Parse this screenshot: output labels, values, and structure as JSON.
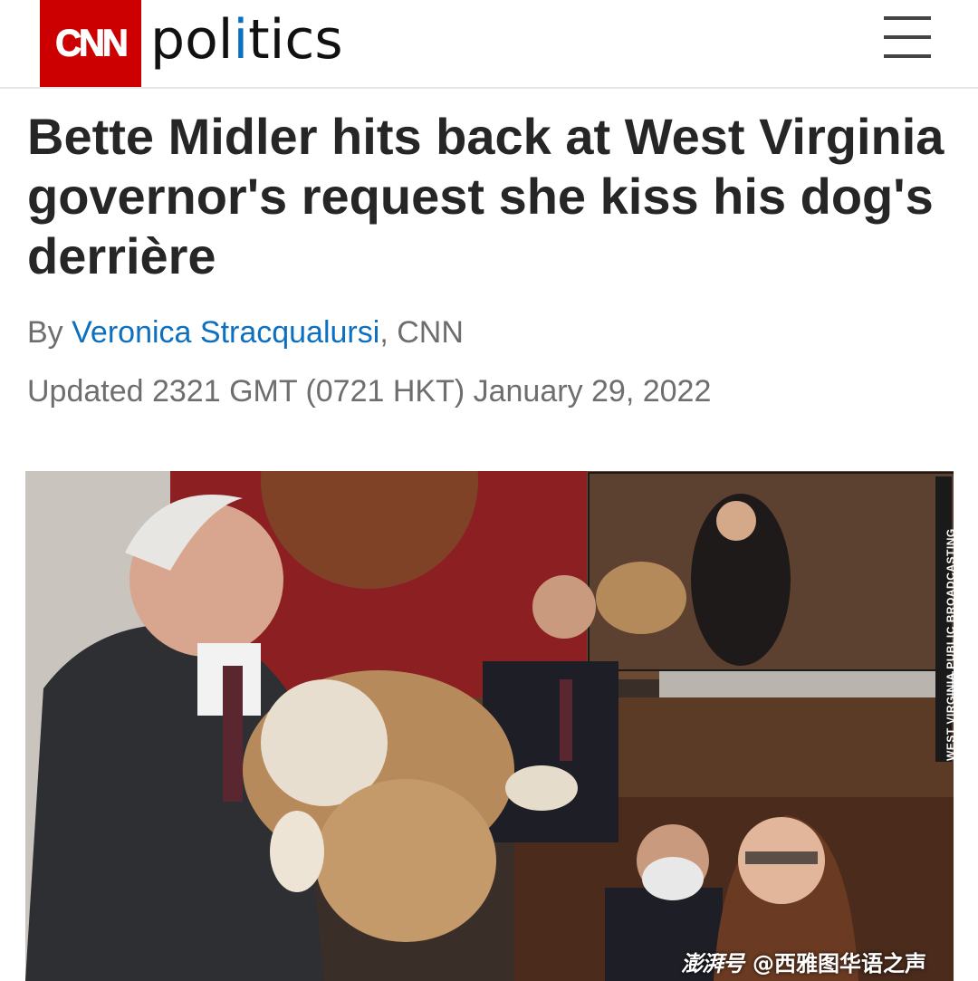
{
  "header": {
    "logo_text": "CNN",
    "section_prefix": "pol",
    "section_i": "i",
    "section_suffix": "tics",
    "menu_icon": "hamburger-menu-icon"
  },
  "article": {
    "headline": "Bette Midler hits back at West Virginia governor's request she kiss his dog's derrière",
    "byline_prefix": "By ",
    "author": "Veronica Stracqualursi",
    "byline_suffix": ", CNN",
    "updated": "Updated 2321 GMT (0721 HKT) January 29, 2022"
  },
  "photo": {
    "credit": "WEST VIRGINIA PUBLIC BROADCASTING",
    "watermark_logo": "澎湃号",
    "watermark_text": "@西雅图华语之声"
  },
  "colors": {
    "brand_red": "#cc0000",
    "link_blue": "#0c6fbf",
    "headline": "#262626",
    "meta_gray": "#6e6e6e"
  }
}
